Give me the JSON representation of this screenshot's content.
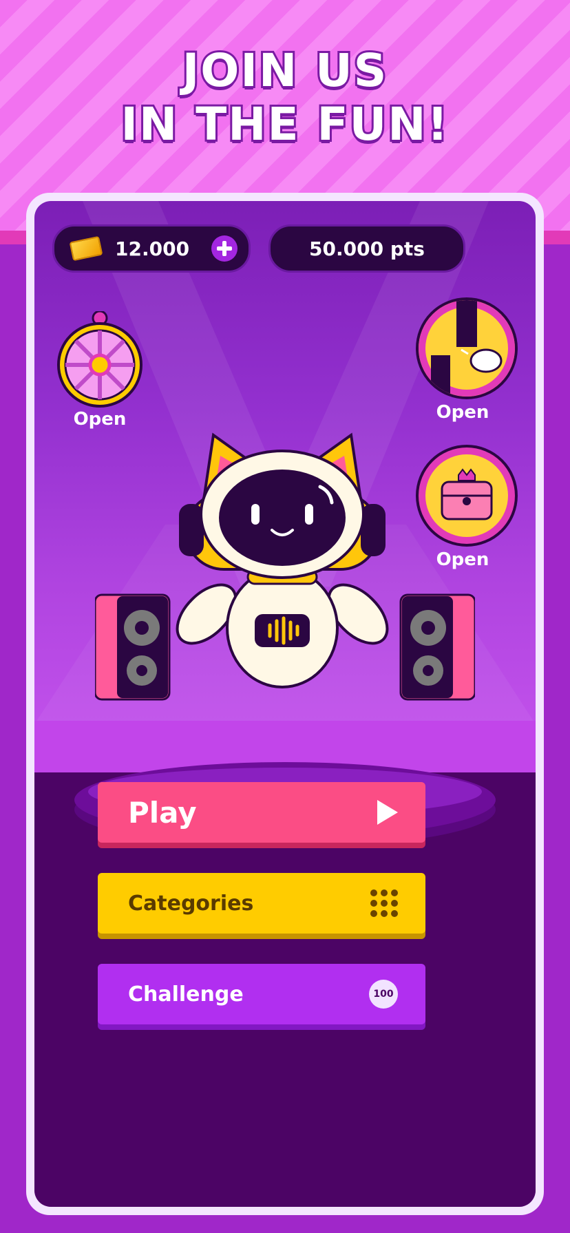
{
  "headline": {
    "line1": "JOIN US",
    "line2": "IN THE FUN!"
  },
  "header": {
    "coins": "12.000",
    "points": "50.000 pts"
  },
  "rewards": {
    "wheel_label": "Open",
    "piano_label": "Open",
    "chest_label": "Open"
  },
  "buttons": {
    "play": "Play",
    "categories": "Categories",
    "challenge": "Challenge",
    "challenge_badge": "100"
  },
  "icons": {
    "coins": "ticket-icon",
    "add": "plus-icon",
    "play": "play-triangle-icon",
    "categories": "grid-dots-icon",
    "wheel": "prize-wheel-icon",
    "piano": "piano-tap-icon",
    "chest": "treasure-chest-icon"
  },
  "colors": {
    "play": "#fb4d85",
    "categories": "#ffcc00",
    "challenge": "#b12ff0",
    "mascot_accent": "#ffc60b"
  }
}
